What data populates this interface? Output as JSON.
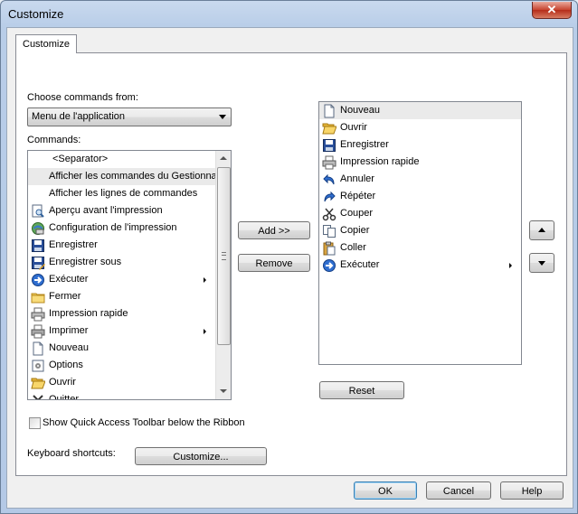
{
  "window": {
    "title": "Customize",
    "close_glyph": "✕"
  },
  "tab": {
    "label": "Customize"
  },
  "choose": {
    "label": "Choose commands from:",
    "selected": "Menu de l'application"
  },
  "commands": {
    "label": "Commands:",
    "items": [
      {
        "label": "<Separator>",
        "icon": "none"
      },
      {
        "label": "Afficher les commandes du Gestionnai",
        "icon": "none",
        "selected": true
      },
      {
        "label": "Afficher les lignes de commandes",
        "icon": "none"
      },
      {
        "label": "Aperçu avant l'impression",
        "icon": "print-preview-icon"
      },
      {
        "label": "Configuration de l'impression",
        "icon": "print-setup-icon"
      },
      {
        "label": "Enregistrer",
        "icon": "save-icon"
      },
      {
        "label": "Enregistrer sous",
        "icon": "save-as-icon"
      },
      {
        "label": "Exécuter",
        "icon": "run-icon",
        "submenu": true
      },
      {
        "label": "Fermer",
        "icon": "close-folder-icon"
      },
      {
        "label": "Impression rapide",
        "icon": "quick-print-icon"
      },
      {
        "label": "Imprimer",
        "icon": "print-icon",
        "submenu": true
      },
      {
        "label": "Nouveau",
        "icon": "new-document-icon"
      },
      {
        "label": "Options",
        "icon": "options-icon"
      },
      {
        "label": "Ouvrir",
        "icon": "open-folder-icon"
      },
      {
        "label": "Quitter",
        "icon": "exit-icon"
      }
    ]
  },
  "toolbar_items": [
    {
      "label": "Nouveau",
      "icon": "new-document-icon",
      "selected": true
    },
    {
      "label": "Ouvrir",
      "icon": "open-folder-icon"
    },
    {
      "label": "Enregistrer",
      "icon": "save-icon"
    },
    {
      "label": "Impression rapide",
      "icon": "quick-print-icon"
    },
    {
      "label": "Annuler",
      "icon": "undo-icon"
    },
    {
      "label": "Répéter",
      "icon": "redo-icon"
    },
    {
      "label": "Couper",
      "icon": "cut-icon"
    },
    {
      "label": "Copier",
      "icon": "copy-icon"
    },
    {
      "label": "Coller",
      "icon": "paste-icon"
    },
    {
      "label": "Exécuter",
      "icon": "run-icon",
      "submenu": true
    }
  ],
  "buttons": {
    "add": "Add >>",
    "remove": "Remove",
    "reset": "Reset",
    "customize": "Customize...",
    "ok": "OK",
    "cancel": "Cancel",
    "help": "Help"
  },
  "checkbox": {
    "label": "Show Quick Access Toolbar below the Ribbon",
    "checked": false
  },
  "keyboard": {
    "label": "Keyboard shortcuts:"
  },
  "colors": {
    "title_bg": "#b8cde8",
    "close_red": "#c7432f",
    "selection": "#eaeaea",
    "ok_border": "#3c7fb1"
  }
}
